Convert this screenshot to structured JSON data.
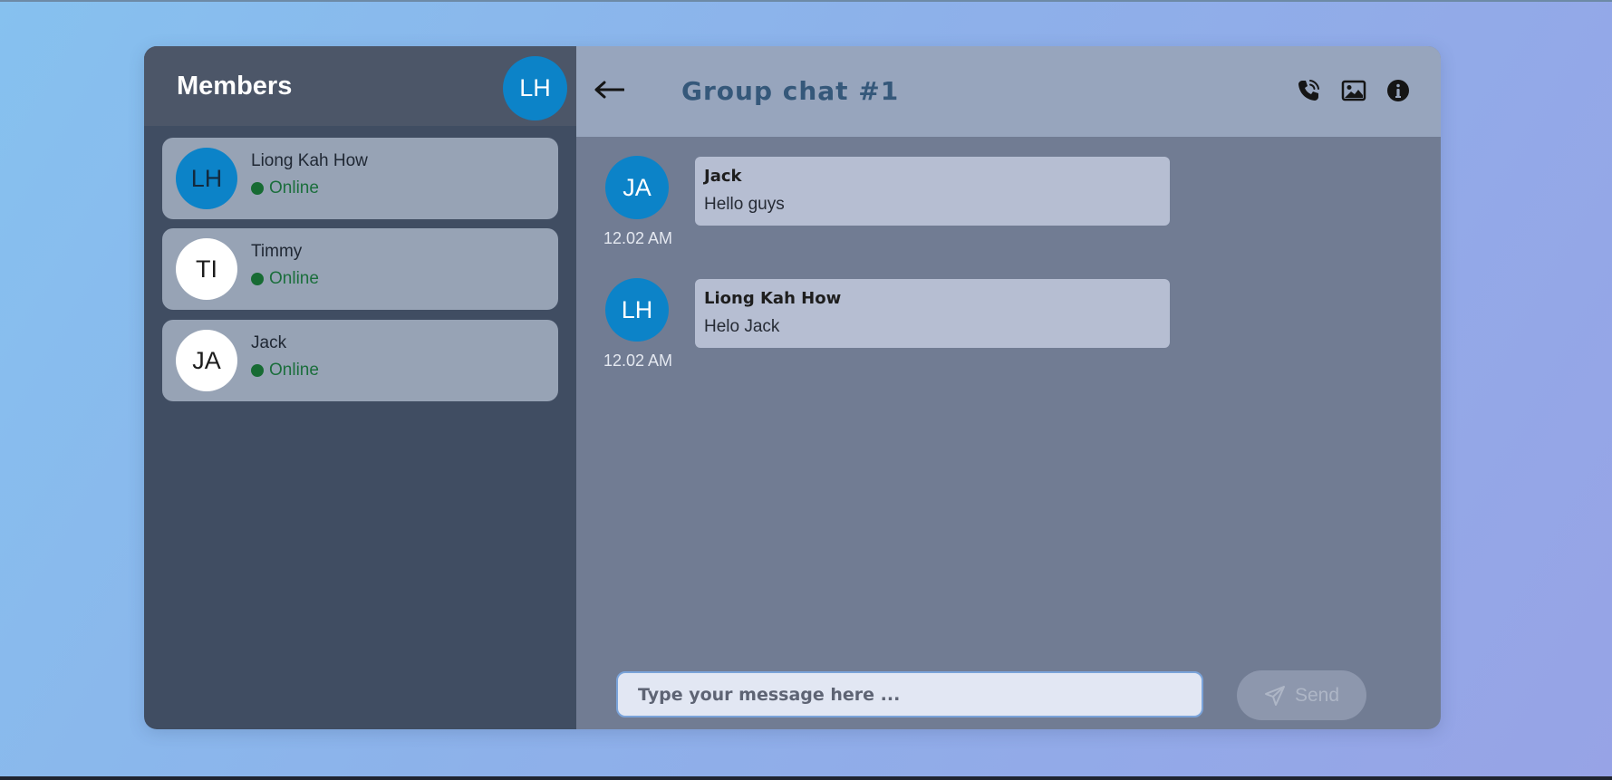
{
  "sidebar": {
    "title": "Members",
    "current_user_initials": "LH",
    "members": [
      {
        "initials": "LH",
        "name": "Liong Kah How",
        "status": "Online",
        "avatar_color": "#0c83c8"
      },
      {
        "initials": "TI",
        "name": "Timmy",
        "status": "Online",
        "avatar_color": "#ffffff"
      },
      {
        "initials": "JA",
        "name": "Jack",
        "status": "Online",
        "avatar_color": "#ffffff"
      }
    ]
  },
  "chat": {
    "title": "Group chat #1",
    "header_icons": [
      "back-arrow-icon",
      "phone-call-icon",
      "image-icon",
      "info-icon"
    ],
    "messages": [
      {
        "initials": "JA",
        "sender": "Jack",
        "text": "Hello guys",
        "time": "12.02 AM"
      },
      {
        "initials": "LH",
        "sender": "Liong Kah How",
        "text": "Helo Jack",
        "time": "12.02 AM"
      }
    ],
    "composer": {
      "placeholder": "Type your message here ...",
      "value": ""
    },
    "send_label": "Send"
  },
  "colors": {
    "accent_avatar": "#0c83c8",
    "online_status": "#1b6e3c",
    "sidebar_bg": "#404d62",
    "chat_bg": "#717c93"
  }
}
